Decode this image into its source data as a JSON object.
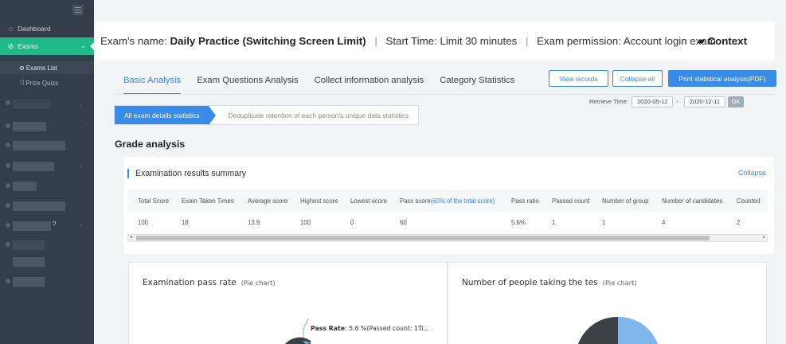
{
  "sidebar": {
    "items": [
      {
        "label": "Dashboard",
        "icon": "home-icon"
      },
      {
        "label": "Exams",
        "icon": "check-circle-icon"
      }
    ],
    "sub_items": [
      {
        "label": "Exams List",
        "icon": "check-circle-icon"
      },
      {
        "label": "Prize Quizs",
        "icon": "shuffle-icon"
      }
    ],
    "hidden_suffix": "?"
  },
  "header": {
    "name_prefix": "Exam's name:",
    "exam_name": "Daily Practice (Switching Screen Limit)",
    "start_time": "Start Time: Limit 30 minutes",
    "permission": "Exam permission: Account login exam",
    "separator": "|",
    "context_label": "Context"
  },
  "tabs": [
    {
      "label": "Basic Analysis",
      "active": true
    },
    {
      "label": "Exam Questions Analysis",
      "active": false
    },
    {
      "label": "Collect information analysis",
      "active": false
    },
    {
      "label": "Category Statistics",
      "active": false
    }
  ],
  "actions": {
    "view_records": "View records",
    "collapse_all": "Collapse all",
    "print_analysis": "Print statistical analysis(PDF)"
  },
  "retrieve": {
    "label": "Retrieve Time:",
    "start_date": "2020-05-11",
    "dash": "-",
    "end_date": "2020-12-11",
    "ok": "OK"
  },
  "segments": [
    {
      "label": "All exam details statistics",
      "active": true
    },
    {
      "label": "Deduplicate retention of each person's unique data statistics",
      "active": false
    }
  ],
  "grade_title": "Grade analysis",
  "summary": {
    "title": "Examination results summary",
    "collapse": "Collapse",
    "headers": [
      "Total Score",
      "Exam Taken Times",
      "Average score",
      "Highest score",
      "Lowest score",
      "Pass score",
      "Pass ratio",
      "Passed count",
      "Number of group",
      "Number of candidates",
      "Counted"
    ],
    "pass_score_note": "(60% of the total score)",
    "row": [
      "100",
      "18",
      "13.9",
      "100",
      "0",
      "60",
      "5.6%",
      "1",
      "1",
      "4",
      "2"
    ]
  },
  "panels": {
    "pass_rate_title": "Examination pass rate",
    "pass_rate_sub": "(Pie chart)",
    "people_title": "Number of people taking the tes",
    "people_sub": "(Pie chart)",
    "pie_label_bold": "Pass Rate",
    "pie_label_rest": ": 5.6 %(Passed count: 1Ti..."
  },
  "colors": {
    "sidebar_bg": "#333e4a",
    "active_green": "#20b98a",
    "accent_blue": "#3a8be7",
    "pie_dark": "#3b4047",
    "pie_light": "#7eb5eb"
  }
}
